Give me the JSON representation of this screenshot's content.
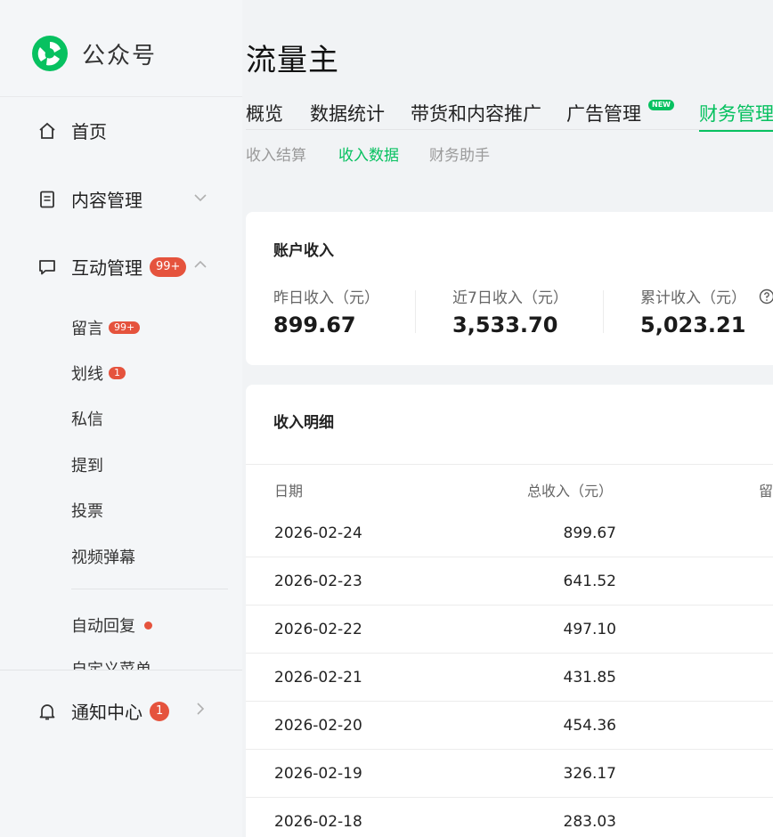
{
  "brand": {
    "name": "公众号"
  },
  "sidebar": {
    "items": [
      {
        "label": "首页"
      },
      {
        "label": "内容管理"
      },
      {
        "label": "互动管理",
        "badge": "99+"
      }
    ],
    "sub_items": [
      {
        "label": "留言",
        "badge": "99+"
      },
      {
        "label": "划线",
        "badge": "1"
      },
      {
        "label": "私信"
      },
      {
        "label": "提到"
      },
      {
        "label": "投票"
      },
      {
        "label": "视频弹幕"
      },
      {
        "label": "自动回复"
      },
      {
        "label": "自定义菜单"
      }
    ],
    "notify": {
      "label": "通知中心",
      "badge": "1"
    }
  },
  "header": {
    "title": "流量主"
  },
  "tabs": [
    {
      "label": "概览"
    },
    {
      "label": "数据统计"
    },
    {
      "label": "带货和内容推广"
    },
    {
      "label": "广告管理",
      "badge": "NEW"
    },
    {
      "label": "财务管理"
    }
  ],
  "subtabs": [
    {
      "label": "收入结算"
    },
    {
      "label": "收入数据"
    },
    {
      "label": "财务助手"
    }
  ],
  "account": {
    "title": "账户收入",
    "stats": [
      {
        "label": "昨日收入（元）",
        "value": "899.67"
      },
      {
        "label": "近7日收入（元）",
        "value": "3,533.70"
      },
      {
        "label": "累计收入（元）",
        "value": "5,023.21"
      }
    ]
  },
  "detail": {
    "title": "收入明细",
    "headers": {
      "date": "日期",
      "total": "总收入（元）",
      "third": "留"
    },
    "rows": [
      {
        "date": "2026-02-24",
        "total": "899.67"
      },
      {
        "date": "2026-02-23",
        "total": "641.52"
      },
      {
        "date": "2026-02-22",
        "total": "497.10"
      },
      {
        "date": "2026-02-21",
        "total": "431.85"
      },
      {
        "date": "2026-02-20",
        "total": "454.36"
      },
      {
        "date": "2026-02-19",
        "total": "326.17"
      },
      {
        "date": "2026-02-18",
        "total": "283.03"
      }
    ]
  },
  "colors": {
    "accent": "#07c160",
    "badge": "#e5533d"
  }
}
